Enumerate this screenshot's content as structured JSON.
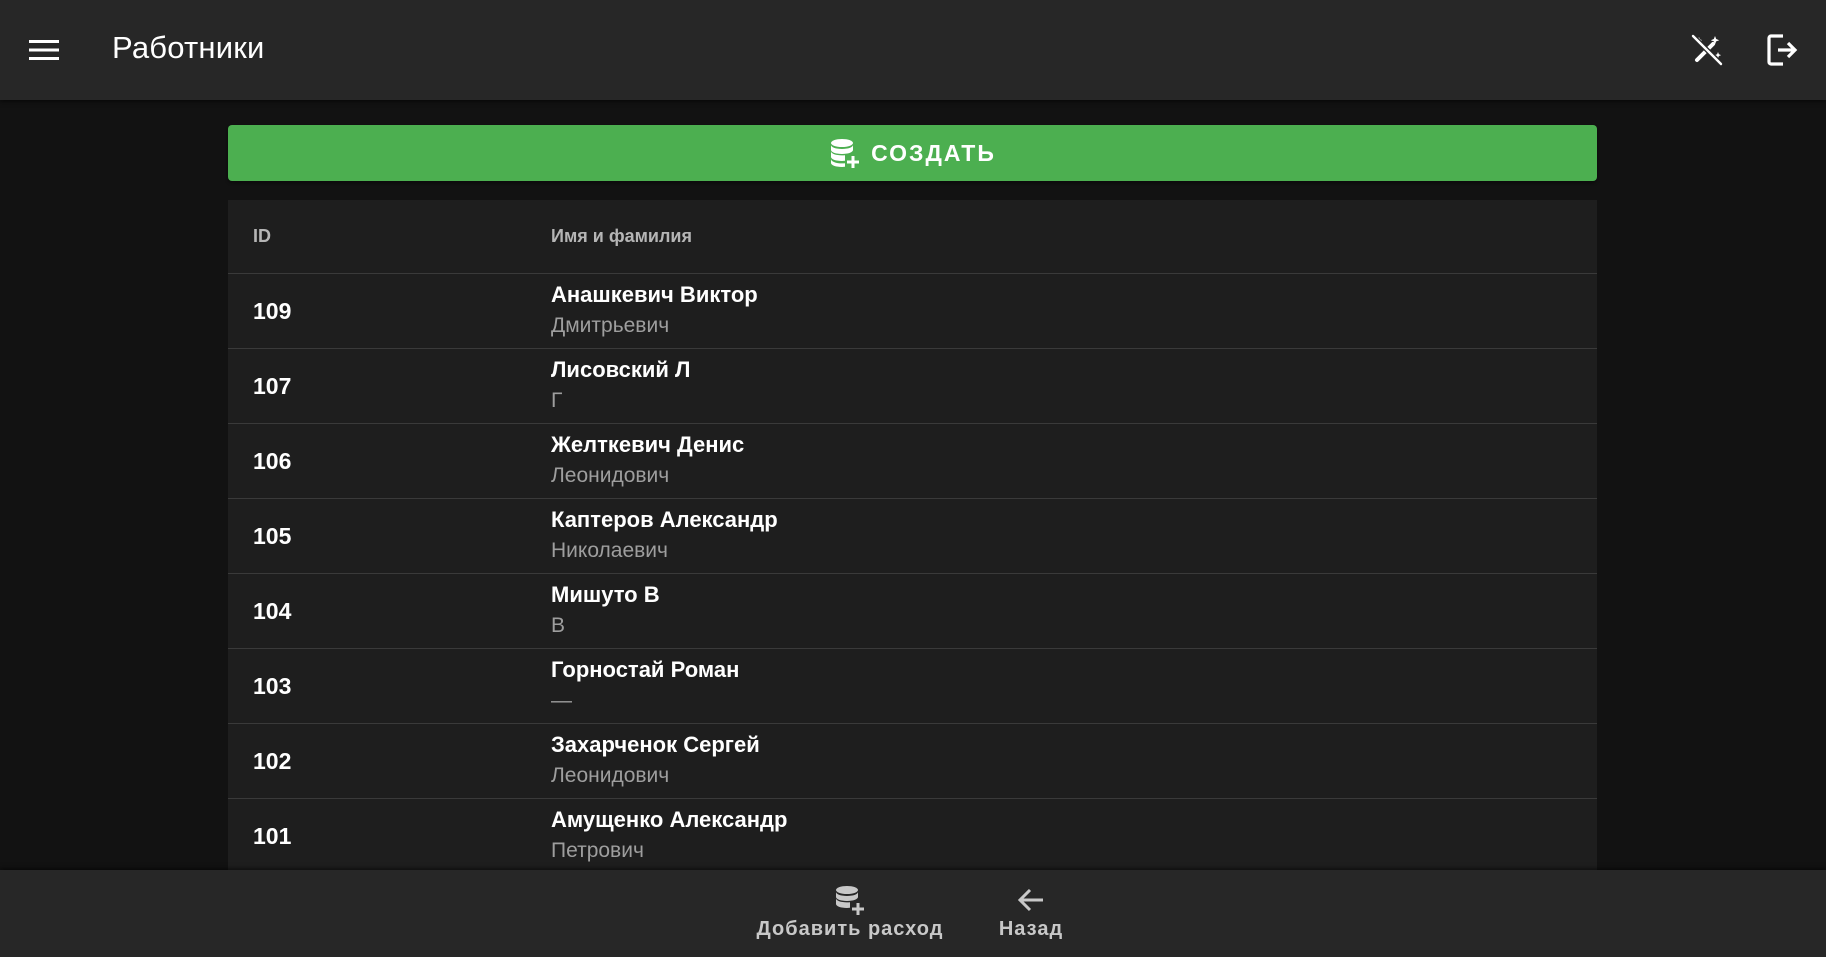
{
  "appbar": {
    "title": "Работники",
    "menu_icon": "menu-icon",
    "theme_icon": "auto-fix-off-icon",
    "logout_icon": "logout-icon"
  },
  "create_button": {
    "label": "СОЗДАТЬ",
    "icon": "database-plus-icon",
    "color": "#4caf50"
  },
  "table": {
    "headers": {
      "id": "ID",
      "name": "Имя и фамилия"
    },
    "rows": [
      {
        "id": "109",
        "name": "Анашкевич Виктор",
        "patronymic": "Дмитрьевич"
      },
      {
        "id": "107",
        "name": "Лисовский Л",
        "patronymic": "Г"
      },
      {
        "id": "106",
        "name": "Желткевич Денис",
        "patronymic": "Леонидович"
      },
      {
        "id": "105",
        "name": "Каптеров Александр",
        "patronymic": "Николаевич"
      },
      {
        "id": "104",
        "name": "Мишуто В",
        "patronymic": "В"
      },
      {
        "id": "103",
        "name": "Горностай Роман",
        "patronymic": "—"
      },
      {
        "id": "102",
        "name": "Захарченок Сергей",
        "patronymic": "Леонидович"
      },
      {
        "id": "101",
        "name": "Амущенко Александр",
        "patronymic": "Петрович"
      }
    ]
  },
  "bottom_nav": {
    "add_expense": {
      "label": "Добавить расход",
      "icon": "database-plus-icon"
    },
    "back": {
      "label": "Назад",
      "icon": "arrow-left-icon"
    }
  }
}
